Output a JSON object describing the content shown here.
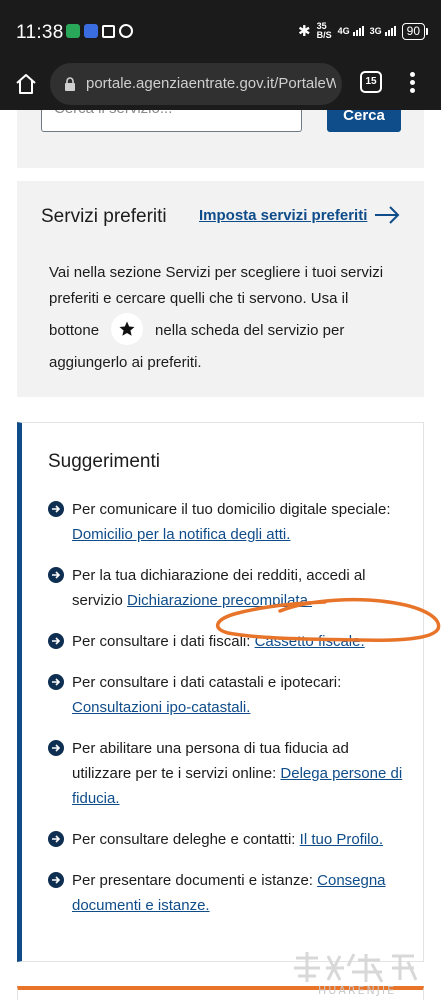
{
  "status_bar": {
    "time": "11:38",
    "network_speed_value": "35",
    "network_speed_unit": "B/S",
    "signal_1": "4G",
    "signal_2": "3G",
    "battery": "90"
  },
  "browser": {
    "url": "portale.agenziaentrate.gov.it/PortaleWel",
    "tab_count": "15"
  },
  "search": {
    "placeholder": "Cerca il servizio...",
    "button_label": "Cerca"
  },
  "favorites": {
    "title": "Servizi preferiti",
    "link_label": "Imposta servizi preferiti",
    "text_line_1": "Vai nella sezione Servizi per scegliere i tuoi servizi",
    "text_line_2": "preferiti e cercare quelli che ti servono. Usa il",
    "text_before_icon": "bottone",
    "text_after_icon": "nella scheda del servizio per",
    "text_line_4": "aggiungerlo ai preferiti."
  },
  "suggestions": {
    "title": "Suggerimenti",
    "items": [
      {
        "text": "Per comunicare il tuo domicilio digitale speciale: ",
        "link": "Domicilio per la notifica degli atti."
      },
      {
        "text": "Per la tua dichiarazione dei redditi, accedi al servizio ",
        "link": "Dichiarazione precompilata."
      },
      {
        "text": "Per consultare i dati fiscali: ",
        "link": "Cassetto fiscale."
      },
      {
        "text": "Per consultare i dati catastali e ipotecari: ",
        "link": "Consultazioni ipo-catastali."
      },
      {
        "text": "Per abilitare una persona di tua fiducia ad utilizzare per te i servizi online: ",
        "link": "Delega persone di fiducia."
      },
      {
        "text": "Per consultare deleghe e contatti: ",
        "link": "Il tuo Profilo."
      },
      {
        "text": "Per presentare documenti e istanze: ",
        "link": "Consegna documenti e istanze."
      }
    ]
  },
  "watermark": {
    "text": "HUARENJIE"
  },
  "colors": {
    "brand_blue": "#0f4c8a",
    "accent_orange": "#e8742a",
    "card_grey": "#f2f2f2"
  }
}
